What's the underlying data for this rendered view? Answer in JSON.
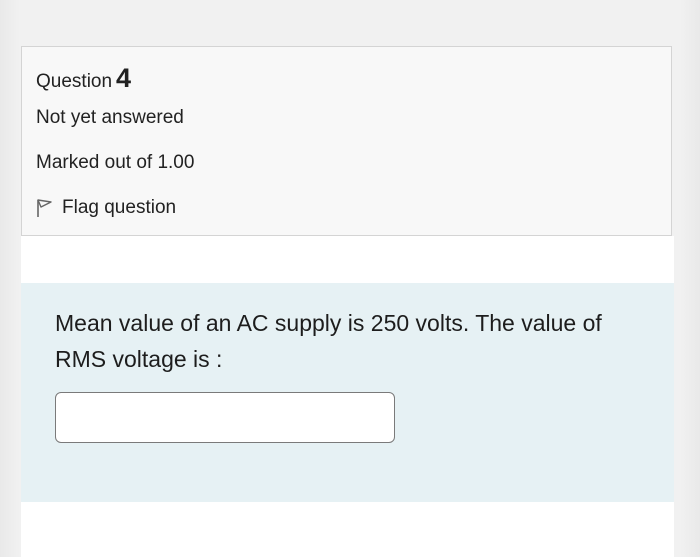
{
  "question": {
    "label": "Question",
    "number": "4",
    "state": "Not yet answered",
    "grade": "Marked out of 1.00",
    "flag_label": "Flag question",
    "text": "Mean value of an AC supply is 250 volts. The value of RMS voltage is :",
    "answer_value": "",
    "answer_placeholder": ""
  },
  "colors": {
    "info_background": "#f8f8f8",
    "content_background": "#e6f1f4",
    "page_background": "#efefef"
  }
}
